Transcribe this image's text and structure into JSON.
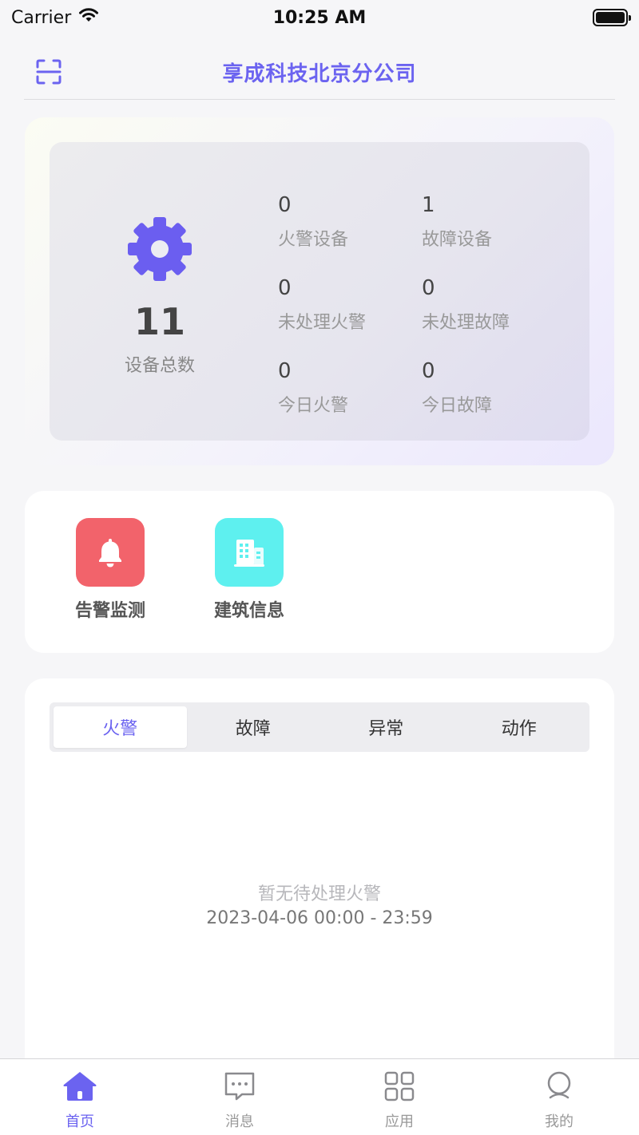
{
  "status_bar": {
    "carrier": "Carrier",
    "time": "10:25 AM"
  },
  "header": {
    "title": "享成科技北京分公司",
    "left_icon": "scan-icon"
  },
  "stats": {
    "total": {
      "value": "11",
      "label": "设备总数",
      "icon": "gear-icon"
    },
    "items": [
      {
        "value": "0",
        "label": "火警设备"
      },
      {
        "value": "1",
        "label": "故障设备"
      },
      {
        "value": "0",
        "label": "未处理火警"
      },
      {
        "value": "0",
        "label": "未处理故障"
      },
      {
        "value": "0",
        "label": "今日火警"
      },
      {
        "value": "0",
        "label": "今日故障"
      }
    ]
  },
  "shortcuts": [
    {
      "label": "告警监测",
      "icon": "bell-icon",
      "color": "#f2636b"
    },
    {
      "label": "建筑信息",
      "icon": "building-icon",
      "color": "#5ef0ef"
    }
  ],
  "alarm_list": {
    "tabs": [
      {
        "label": "火警",
        "active": true
      },
      {
        "label": "故障",
        "active": false
      },
      {
        "label": "异常",
        "active": false
      },
      {
        "label": "动作",
        "active": false
      }
    ],
    "empty_text": "暂无待处理火警",
    "date_range": "2023-04-06 00:00 - 23:59"
  },
  "tab_bar": {
    "items": [
      {
        "label": "首页",
        "icon": "home-icon",
        "active": true
      },
      {
        "label": "消息",
        "icon": "message-icon",
        "active": false
      },
      {
        "label": "应用",
        "icon": "apps-icon",
        "active": false
      },
      {
        "label": "我的",
        "icon": "profile-icon",
        "active": false
      }
    ]
  },
  "colors": {
    "accent": "#6b63f0",
    "background": "#f6f6f8"
  }
}
